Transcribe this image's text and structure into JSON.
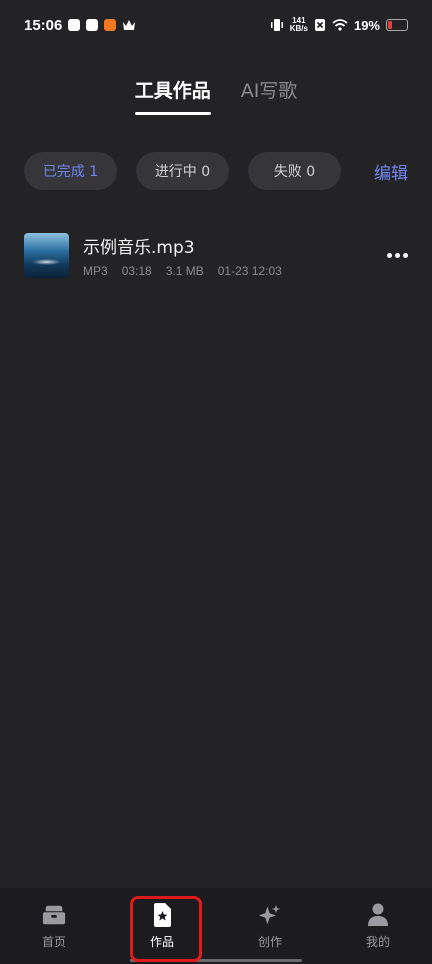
{
  "status": {
    "time": "15:06",
    "net_speed_top": "141",
    "net_speed_bottom": "KB/s",
    "battery": "19%"
  },
  "tabs": [
    {
      "label": "工具作品",
      "active": true
    },
    {
      "label": "AI写歌",
      "active": false
    }
  ],
  "filters": [
    {
      "label": "已完成 1",
      "active": true
    },
    {
      "label": "进行中 0",
      "active": false
    },
    {
      "label": "失败 0",
      "active": false
    }
  ],
  "edit_label": "编辑",
  "item": {
    "title": "示例音乐.mp3",
    "format": "MP3",
    "duration": "03:18",
    "size": "3.1 MB",
    "date": "01-23 12:03"
  },
  "nav": [
    {
      "label": "首页",
      "icon": "toolbox-icon",
      "active": false
    },
    {
      "label": "作品",
      "icon": "star-document-icon",
      "active": true
    },
    {
      "label": "创作",
      "icon": "sparkle-icon",
      "active": false
    },
    {
      "label": "我的",
      "icon": "person-icon",
      "active": false
    }
  ],
  "colors": {
    "background": "#232325",
    "accent": "#6f86f0",
    "highlight": "#e01a1a"
  }
}
